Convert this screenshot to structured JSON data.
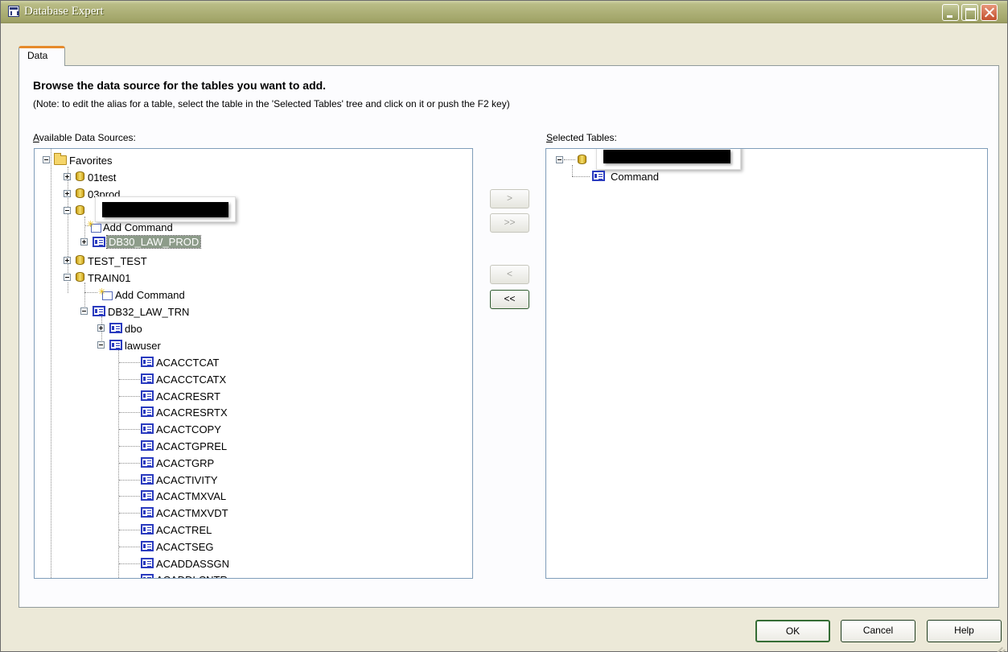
{
  "window": {
    "title": "Database Expert"
  },
  "tabs": [
    {
      "label": "Data"
    }
  ],
  "content": {
    "heading": "Browse the data source for the tables you want to add.",
    "note": "(Note: to edit the alias for a table, select the table in the 'Selected Tables' tree and click on it or push the F2 key)",
    "available_label": "Available Data Sources:",
    "selected_label": "Selected Tables:"
  },
  "available_tree": {
    "favorites": "Favorites",
    "n01test": "01test",
    "n03prod": "03prod",
    "redacted_add_command": "Add Command",
    "db30": "DB30_LAW_PROD",
    "test_test": "TEST_TEST",
    "train01": "TRAIN01",
    "train_add_command": "Add Command",
    "db32": "DB32_LAW_TRN",
    "dbo": "dbo",
    "lawuser": "lawuser",
    "tables": [
      "ACACCTCAT",
      "ACACCTCATX",
      "ACACRESRT",
      "ACACRESRTX",
      "ACACTCOPY",
      "ACACTGPREL",
      "ACACTGRP",
      "ACACTIVITY",
      "ACACTMXVAL",
      "ACACTMXVDT",
      "ACACTREL",
      "ACACTSEG",
      "ACADDASSGN",
      "ACADDLCNTR"
    ]
  },
  "selected_tree": {
    "command": "Command"
  },
  "transfer_buttons": [
    {
      "label": ">"
    },
    {
      "label": ">>"
    },
    {
      "label": "<"
    },
    {
      "label": "<<"
    }
  ],
  "footer": {
    "ok": "OK",
    "cancel": "Cancel",
    "help": "Help"
  }
}
